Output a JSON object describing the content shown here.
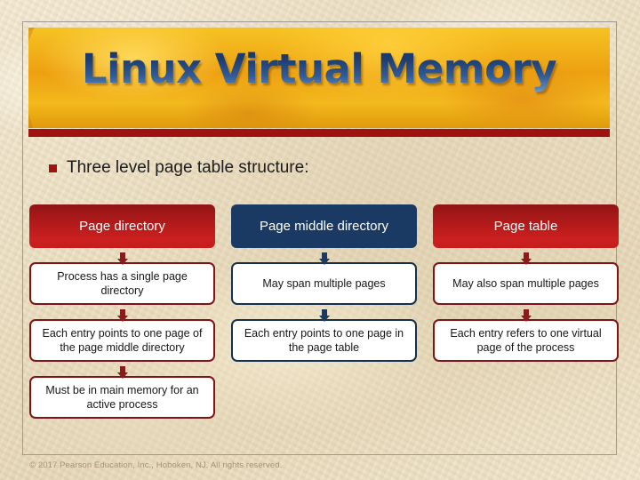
{
  "slide": {
    "title": "Linux Virtual Memory",
    "bullet": {
      "marker": "square-bullet",
      "text": "Three level page table structure:"
    },
    "footer": "© 2017 Pearson Education, Inc., Hoboken, NJ. All rights reserved."
  },
  "colors": {
    "banner_gold": "#eda011",
    "red_bar": "#9e1212",
    "header_red": "#bd1c1c",
    "header_blue": "#1b3a63",
    "frame_gray": "#9b9b9b",
    "paper": "#eadfc4",
    "title_blue_dark": "#16305e",
    "title_blue_light": "#9db8d6"
  },
  "diagram": {
    "columns": [
      {
        "header": "Page directory",
        "accent": "red",
        "cells": [
          "Process has a single page directory",
          "Each entry points to one page of the page middle directory",
          "Must be in main memory for an active process"
        ]
      },
      {
        "header": "Page middle directory",
        "accent": "blue",
        "cells": [
          "May span multiple pages",
          "Each entry points to one page in the page table"
        ]
      },
      {
        "header": "Page table",
        "accent": "red",
        "cells": [
          "May also span multiple pages",
          "Each entry refers to one virtual page of the process"
        ]
      }
    ]
  }
}
